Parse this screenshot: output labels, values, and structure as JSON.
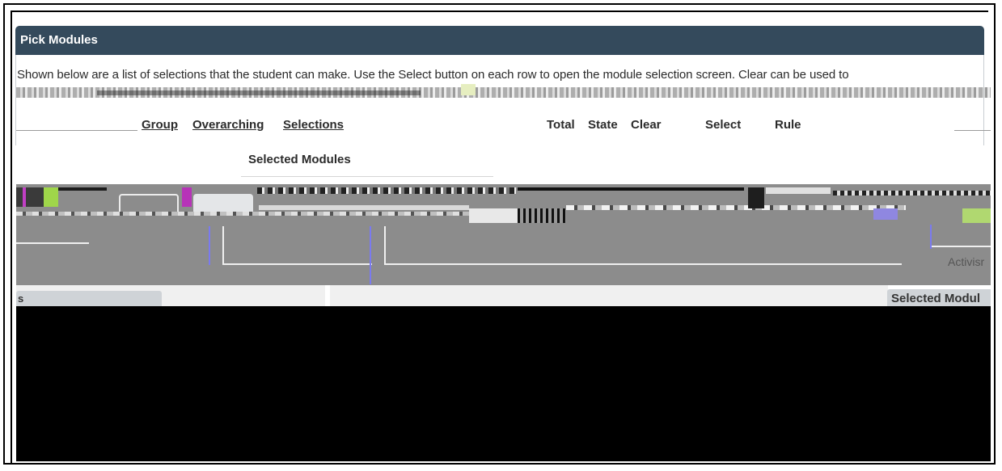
{
  "panel": {
    "title": "Pick Modules",
    "description": "Shown below are a list of selections that the student can make. Use the Select button on each row to open the module selection screen. Clear can be used to"
  },
  "table": {
    "columns": {
      "group": "Group",
      "overarching": "Overarching",
      "selections": "Selections",
      "total": "Total",
      "state": "State",
      "clear": "Clear",
      "select": "Select",
      "rule": "Rule"
    }
  },
  "selected_modules_popup": {
    "title": "Selected Modules"
  },
  "lower": {
    "left_tab_fragment": "s",
    "right_tab_fragment": "Selected Modul",
    "activity_fragment": "Activisr"
  }
}
